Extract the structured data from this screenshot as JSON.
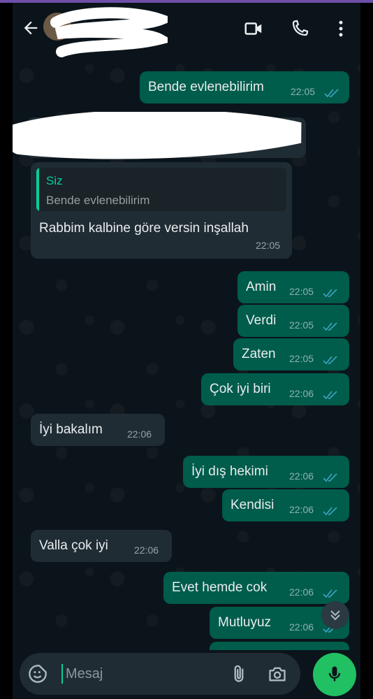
{
  "header": {
    "contact_name": ""
  },
  "messages": [
    {
      "dir": "out",
      "text": "Bende evlenebilirim",
      "time": "22:05",
      "status": "read"
    },
    {
      "dir": "in",
      "reply_to": {
        "name": "Siz",
        "text": "Bende evlenebilirim"
      },
      "text": "Rabbim kalbine göre versin inşallah",
      "time": "22:05"
    },
    {
      "dir": "out",
      "text": "Amin",
      "time": "22:05",
      "status": "read"
    },
    {
      "dir": "out",
      "text": "Verdi",
      "time": "22:05",
      "status": "read"
    },
    {
      "dir": "out",
      "text": "Zaten",
      "time": "22:05",
      "status": "read"
    },
    {
      "dir": "out",
      "text": "Çok iyi biri",
      "time": "22:06",
      "status": "read"
    },
    {
      "dir": "in",
      "text": "İyi bakalım",
      "time": "22:06"
    },
    {
      "dir": "out",
      "text": "İyi dış hekimi",
      "time": "22:06",
      "status": "read"
    },
    {
      "dir": "out",
      "text": "Kendisi",
      "time": "22:06",
      "status": "read"
    },
    {
      "dir": "in",
      "text": "Valla çok iyi",
      "time": "22:06"
    },
    {
      "dir": "out",
      "text": "Evet hemde cok",
      "time": "22:06",
      "status": "read"
    },
    {
      "dir": "out",
      "text": "Mutluyuz",
      "time": "22:06",
      "status": "read"
    }
  ],
  "composer": {
    "placeholder": "Mesaj"
  },
  "icons": {
    "back": "arrow-left-icon",
    "video": "video-call-icon",
    "call": "phone-icon",
    "menu": "kebab-menu-icon",
    "emoji": "sticker-icon",
    "attach": "paperclip-icon",
    "camera": "camera-icon",
    "mic": "microphone-icon",
    "scroll": "double-chevron-down-icon",
    "read": "double-check-icon"
  },
  "colors": {
    "outgoing": "#005c4b",
    "incoming": "#202c33",
    "accent": "#06cf9c",
    "mic": "#21c063"
  }
}
